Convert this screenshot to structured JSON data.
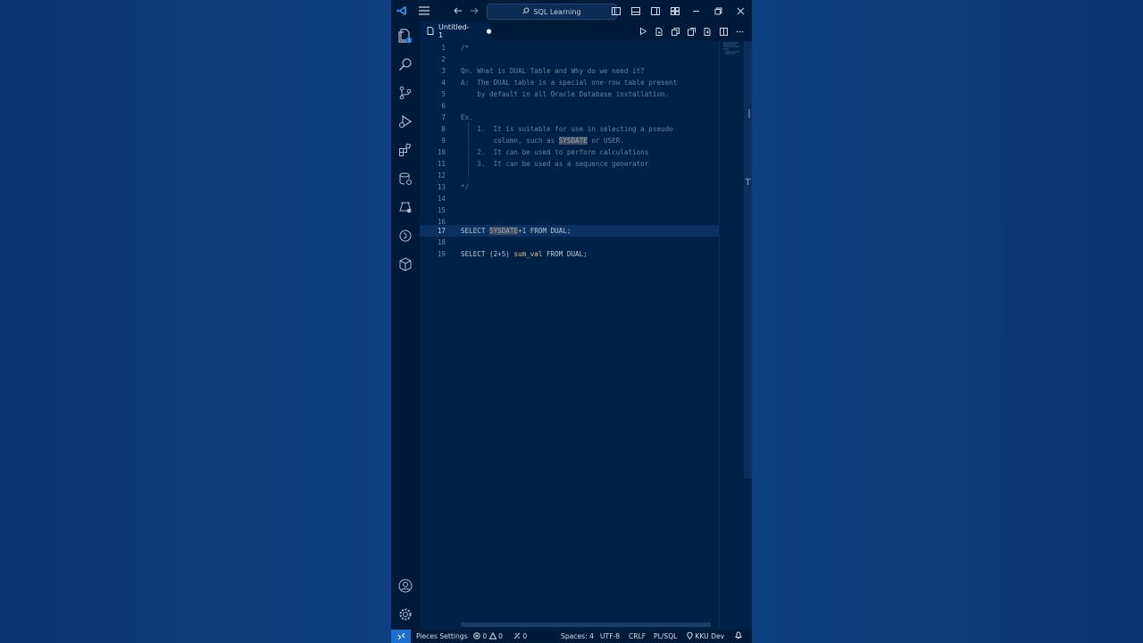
{
  "colors": {
    "accent": "#1d6fcf",
    "editor_bg": "#002147",
    "desktop_bg": "#0d3b7a"
  },
  "titlebar": {
    "search_label": "SQL Learning"
  },
  "tab": {
    "title": "Untitled-1",
    "dirty_marker": "●"
  },
  "editor": {
    "lines": [
      {
        "n": "1",
        "text": "/*"
      },
      {
        "n": "2",
        "text": ""
      },
      {
        "n": "3",
        "text": "Qn. What is DUAL Table and Why do we need it?"
      },
      {
        "n": "4",
        "text": "A:  The DUAL table is a special one-row table present"
      },
      {
        "n": "5",
        "text": "    by default in all Oracle Database installation."
      },
      {
        "n": "6",
        "text": ""
      },
      {
        "n": "7",
        "text": "Ex."
      },
      {
        "n": "8",
        "text": "    1.  It is suitable for use in selecting a pseudo"
      },
      {
        "n": "9",
        "a": "        column, such as ",
        "hl": "SYSDATE",
        "b": " or USER."
      },
      {
        "n": "10",
        "text": "    2.  It can be used to perform calculations"
      },
      {
        "n": "11",
        "text": "    3.  It can be used as a sequence generator"
      },
      {
        "n": "12",
        "text": ""
      },
      {
        "n": "13",
        "text": "*/"
      },
      {
        "n": "14",
        "text": ""
      },
      {
        "n": "15",
        "text": ""
      },
      {
        "n": "16",
        "text": ""
      },
      {
        "n": "17",
        "kw1": "SELECT ",
        "hl": "SYSDATE",
        "rest": "+1 FROM DUAL;"
      },
      {
        "n": "18",
        "text": ""
      },
      {
        "n": "19",
        "kw1": "SELECT (2+5) ",
        "fn": "sum_val",
        "rest": " FROM DUAL;"
      }
    ]
  },
  "statusbar": {
    "pieces": "Pieces Settings",
    "errors": "0",
    "warnings": "0",
    "ports": "0",
    "spaces": "Spaces: 4",
    "encoding": "UTF-8",
    "eol": "CRLF",
    "language": "PL/SQL",
    "profile": "KKU Dev"
  }
}
